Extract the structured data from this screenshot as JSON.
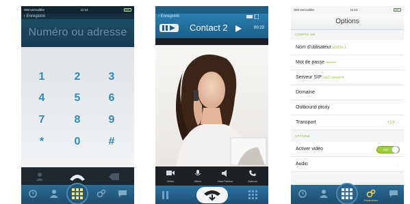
{
  "keypad_screen": {
    "status": {
      "carrier": "SIM verrouillée",
      "time": "11:14"
    },
    "back_label": "‹ Enregistré",
    "number_placeholder": "Numéro ou adresse",
    "keys": [
      "1",
      "2",
      "3",
      "4",
      "5",
      "6",
      "7",
      "8",
      "9",
      "*",
      "0",
      "#"
    ],
    "tabs": [
      "",
      "",
      "",
      "",
      ""
    ]
  },
  "call_screen": {
    "status": {
      "carrier": "",
      "time": ""
    },
    "back_label": "‹ Enregistré",
    "contact_name": "Contact 2",
    "timer": "00:23",
    "controls": [
      "Vidéo",
      "Micro",
      "Haut Parleur",
      "Options"
    ],
    "accent": "#2a7fb1"
  },
  "options_screen": {
    "status": {
      "carrier": "SIM verrouillée",
      "time": "11:13"
    },
    "title": "Options",
    "sections": {
      "account": "COMPTE SIP",
      "options": "OPTIONS"
    },
    "rows": {
      "username": {
        "label": "Nom d'utilisateur",
        "value": "p0000-1"
      },
      "password": {
        "label": "Mot de passe",
        "value": "••••••••"
      },
      "server": {
        "label": "Serveur SIP",
        "value": "sip2.castel.fr"
      },
      "domain": {
        "label": "Domaine"
      },
      "proxy": {
        "label": "Outbound proxy"
      },
      "transport": {
        "label": "Transport",
        "value": "TCP"
      },
      "video": {
        "label": "Activer vidéo",
        "toggle": "ON"
      },
      "audio": {
        "label": "Audio"
      }
    },
    "active_tab_label": "Paramètres",
    "accent": "#9cc740"
  }
}
